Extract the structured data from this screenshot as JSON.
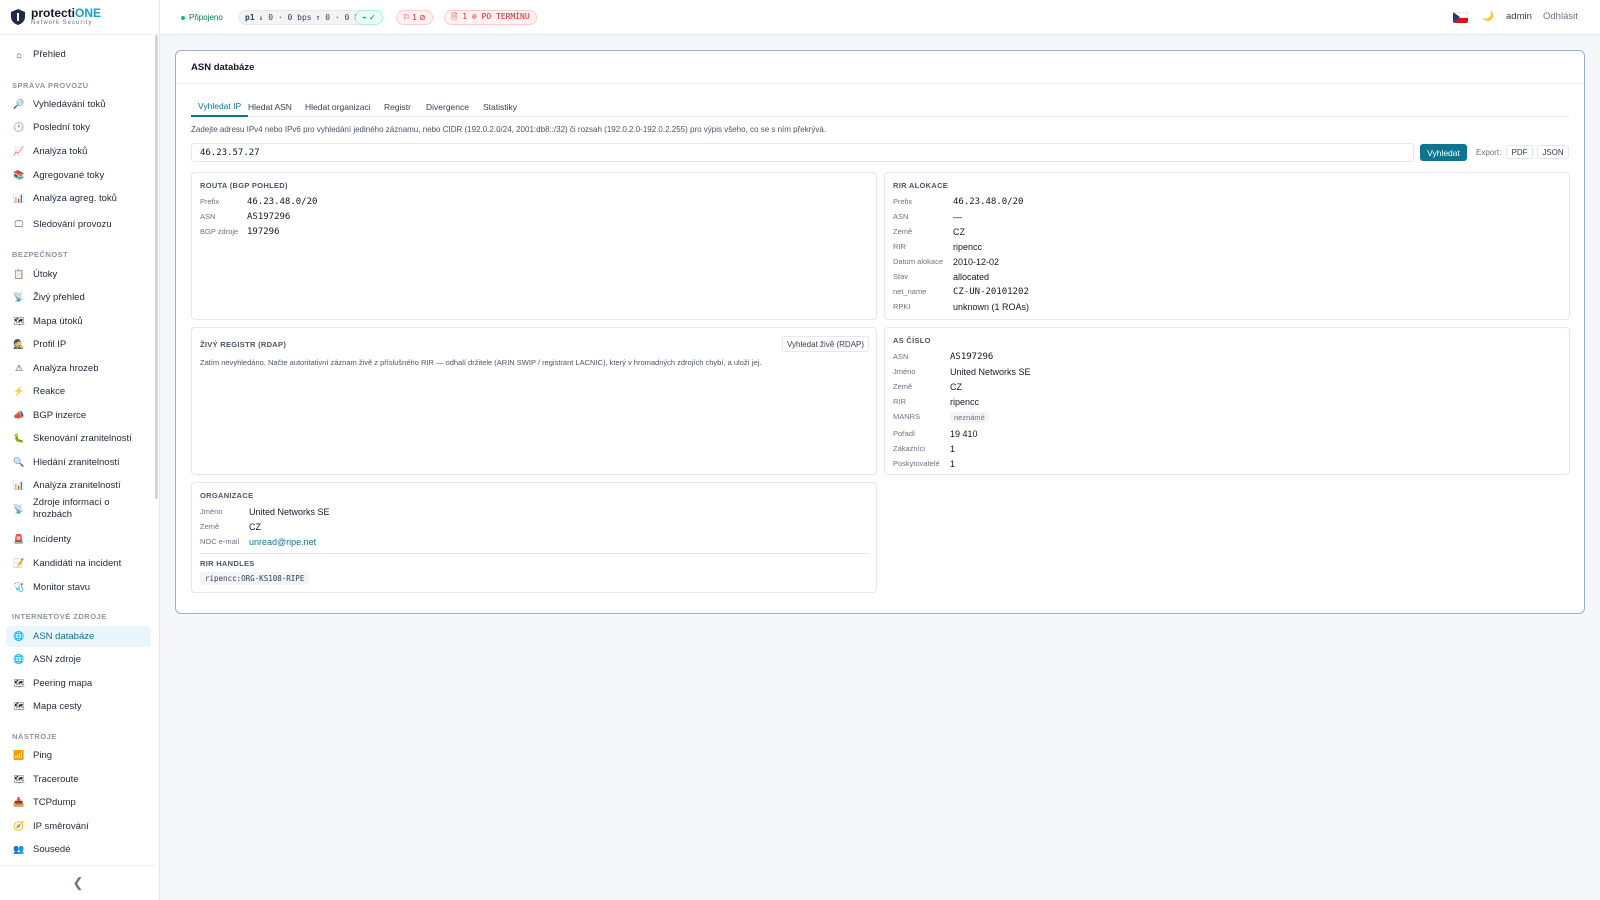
{
  "brand": {
    "name_a": "protecti",
    "name_b": "ONE",
    "subtitle": "Network Security"
  },
  "topbar": {
    "status": "Připojeno",
    "traffic": {
      "name": "p1",
      "down": "↓ 0 · 0 bps",
      "up": "↑ 0 · 0 bps"
    },
    "health": "⌁ ✓",
    "flags": "⚐ 1 ⊘",
    "overdue": "🗎 1 ⊘ PO TERMÍNU",
    "user": "admin",
    "logout": "Odhlásit",
    "theme_icon": "🌙"
  },
  "sidebar": {
    "overview": "Přehled",
    "sections": {
      "traffic": "SPRÁVA PROVOZU",
      "security": "BEZPEČNOST",
      "internet": "INTERNETOVÉ ZDROJE",
      "tools": "NÁSTROJE"
    },
    "items": {
      "flow_search": "Vyhledávání toků",
      "recent_flows": "Poslední toky",
      "flow_analysis": "Analýza toků",
      "aggregated_flows": "Agregované toky",
      "aggregated_analysis": "Analýza agreg. toků",
      "traffic_monitoring": "Sledování provozu",
      "attacks": "Útoky",
      "live_overview": "Živý přehled",
      "attack_map": "Mapa útoků",
      "ip_profile": "Profil IP",
      "threat_analysis": "Analýza hrozeb",
      "reactions": "Reakce",
      "bgp_injection": "BGP inzerce",
      "vuln_scan": "Skenování zranitelností",
      "vuln_search": "Hledání zranitelností",
      "vuln_analysis": "Analýza zranitelností",
      "threat_feeds": "Zdroje informací o hrozbách",
      "incidents": "Incidenty",
      "incident_candidates": "Kandidáti na incident",
      "health_monitor": "Monitor stavu",
      "asn_db": "ASN databáze",
      "asn_sources": "ASN zdroje",
      "peering_map": "Peering mapa",
      "path_map": "Mapa cesty",
      "ping": "Ping",
      "traceroute": "Traceroute",
      "tcpdump": "TCPdump",
      "ip_routing": "IP směrování",
      "neighbors": "Sousedé"
    },
    "collapse": "❮"
  },
  "main": {
    "title": "ASN databáze",
    "tabs": [
      "Vyhledat IP",
      "Hledat ASN",
      "Hledat organizaci",
      "Registr",
      "Divergence",
      "Statistiky"
    ],
    "hint": "Zadejte adresu IPv4 nebo IPv6 pro vyhledání jediného záznamu, nebo CIDR (192.0.2.0/24, 2001:db8::/32) či rozsah (192.0.2.0-192.0.2.255) pro výpis všeho, co se s ním překrývá.",
    "query": "46.23.57.27",
    "search_btn": "Vyhledat",
    "export_label": "Export:",
    "export_pdf": "PDF",
    "export_json": "JSON",
    "route": {
      "title": "ROUTA (BGP POHLED)",
      "prefix_k": "Prefix",
      "prefix_v": "46.23.48.0/20",
      "asn_k": "ASN",
      "asn_v": "AS197296",
      "bgp_k": "BGP zdroje",
      "bgp_v": "197296"
    },
    "rir": {
      "title": "RIR ALOKACE",
      "prefix_k": "Prefix",
      "prefix_v": "46.23.48.0/20",
      "asn_k": "ASN",
      "asn_v": "—",
      "country_k": "Země",
      "country_v": "CZ",
      "rir_k": "RIR",
      "rir_v": "ripencc",
      "date_k": "Datum alokace",
      "date_v": "2010-12-02",
      "state_k": "Stav",
      "state_v": "allocated",
      "netname_k": "net_name",
      "netname_v": "CZ-UN-20101202",
      "rpki_k": "RPKI",
      "rpki_v": "unknown (1 ROAs)"
    },
    "rdap": {
      "title": "ŽIVÝ REGISTR (RDAP)",
      "button": "Vyhledat živě (RDAP)",
      "text": "Zatím nevyhledáno. Načte autoritativní záznam živě z příslušného RIR — odhalí držitele (ARIN SWIP / registrant LACNIC), který v hromadných zdrojích chybí, a uloží jej."
    },
    "as": {
      "title": "AS ČÍSLO",
      "asn_k": "ASN",
      "asn_v": "AS197296",
      "name_k": "Jméno",
      "name_v": "United Networks SE",
      "country_k": "Země",
      "country_v": "CZ",
      "rir_k": "RIR",
      "rir_v": "ripencc",
      "manrs_k": "MANRS",
      "manrs_v": "neznámé",
      "rank_k": "Pořadí",
      "rank_v": "19 410",
      "customers_k": "Zákazníci",
      "customers_v": "1",
      "providers_k": "Poskytovatelé",
      "providers_v": "1"
    },
    "org": {
      "title": "ORGANIZACE",
      "name_k": "Jméno",
      "name_v": "United Networks SE",
      "country_k": "Země",
      "country_v": "CZ",
      "noc_k": "NOC e-mail",
      "noc_v": "unread@ripe.net",
      "handles_title": "RIR HANDLES",
      "handle": "ripencc:ORG-KS108-RIPE"
    }
  },
  "colors": {
    "accent": "#0e7490",
    "brand": "#0ea5c6",
    "danger": "#dc2626",
    "ok": "#10b981"
  }
}
